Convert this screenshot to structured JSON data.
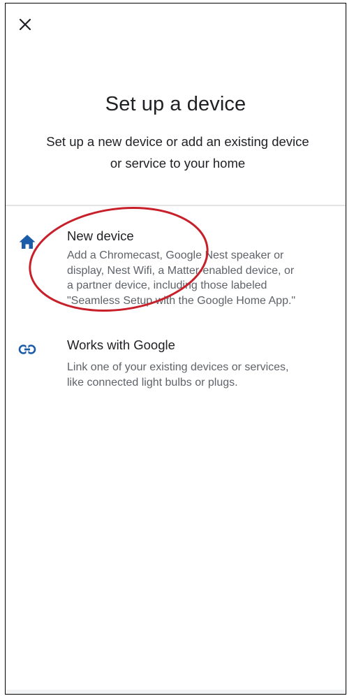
{
  "header": {
    "close_icon": "close-icon"
  },
  "page": {
    "title": "Set up a device",
    "subtitle_line1": "Set up a new device or add an existing device",
    "subtitle_line2": "or service to your home"
  },
  "options": [
    {
      "icon": "home-icon",
      "title": "New device",
      "desc_lines": [
        "Add a Chromecast, Google Nest speaker or",
        "display, Nest Wifi, a Matter-enabled device, or",
        "a partner device, including those labeled",
        "\"Seamless Setup with the Google Home App.\""
      ]
    },
    {
      "icon": "link-icon",
      "title": "Works with Google",
      "desc_lines": [
        "Link one of your existing devices or services,",
        "like connected light bulbs or plugs."
      ]
    }
  ],
  "colors": {
    "icon_blue": "#1a5ca8",
    "annotation_red": "#c8202a",
    "title_text": "#202124",
    "secondary_text": "#5f6368",
    "divider": "#e3e3e3"
  }
}
